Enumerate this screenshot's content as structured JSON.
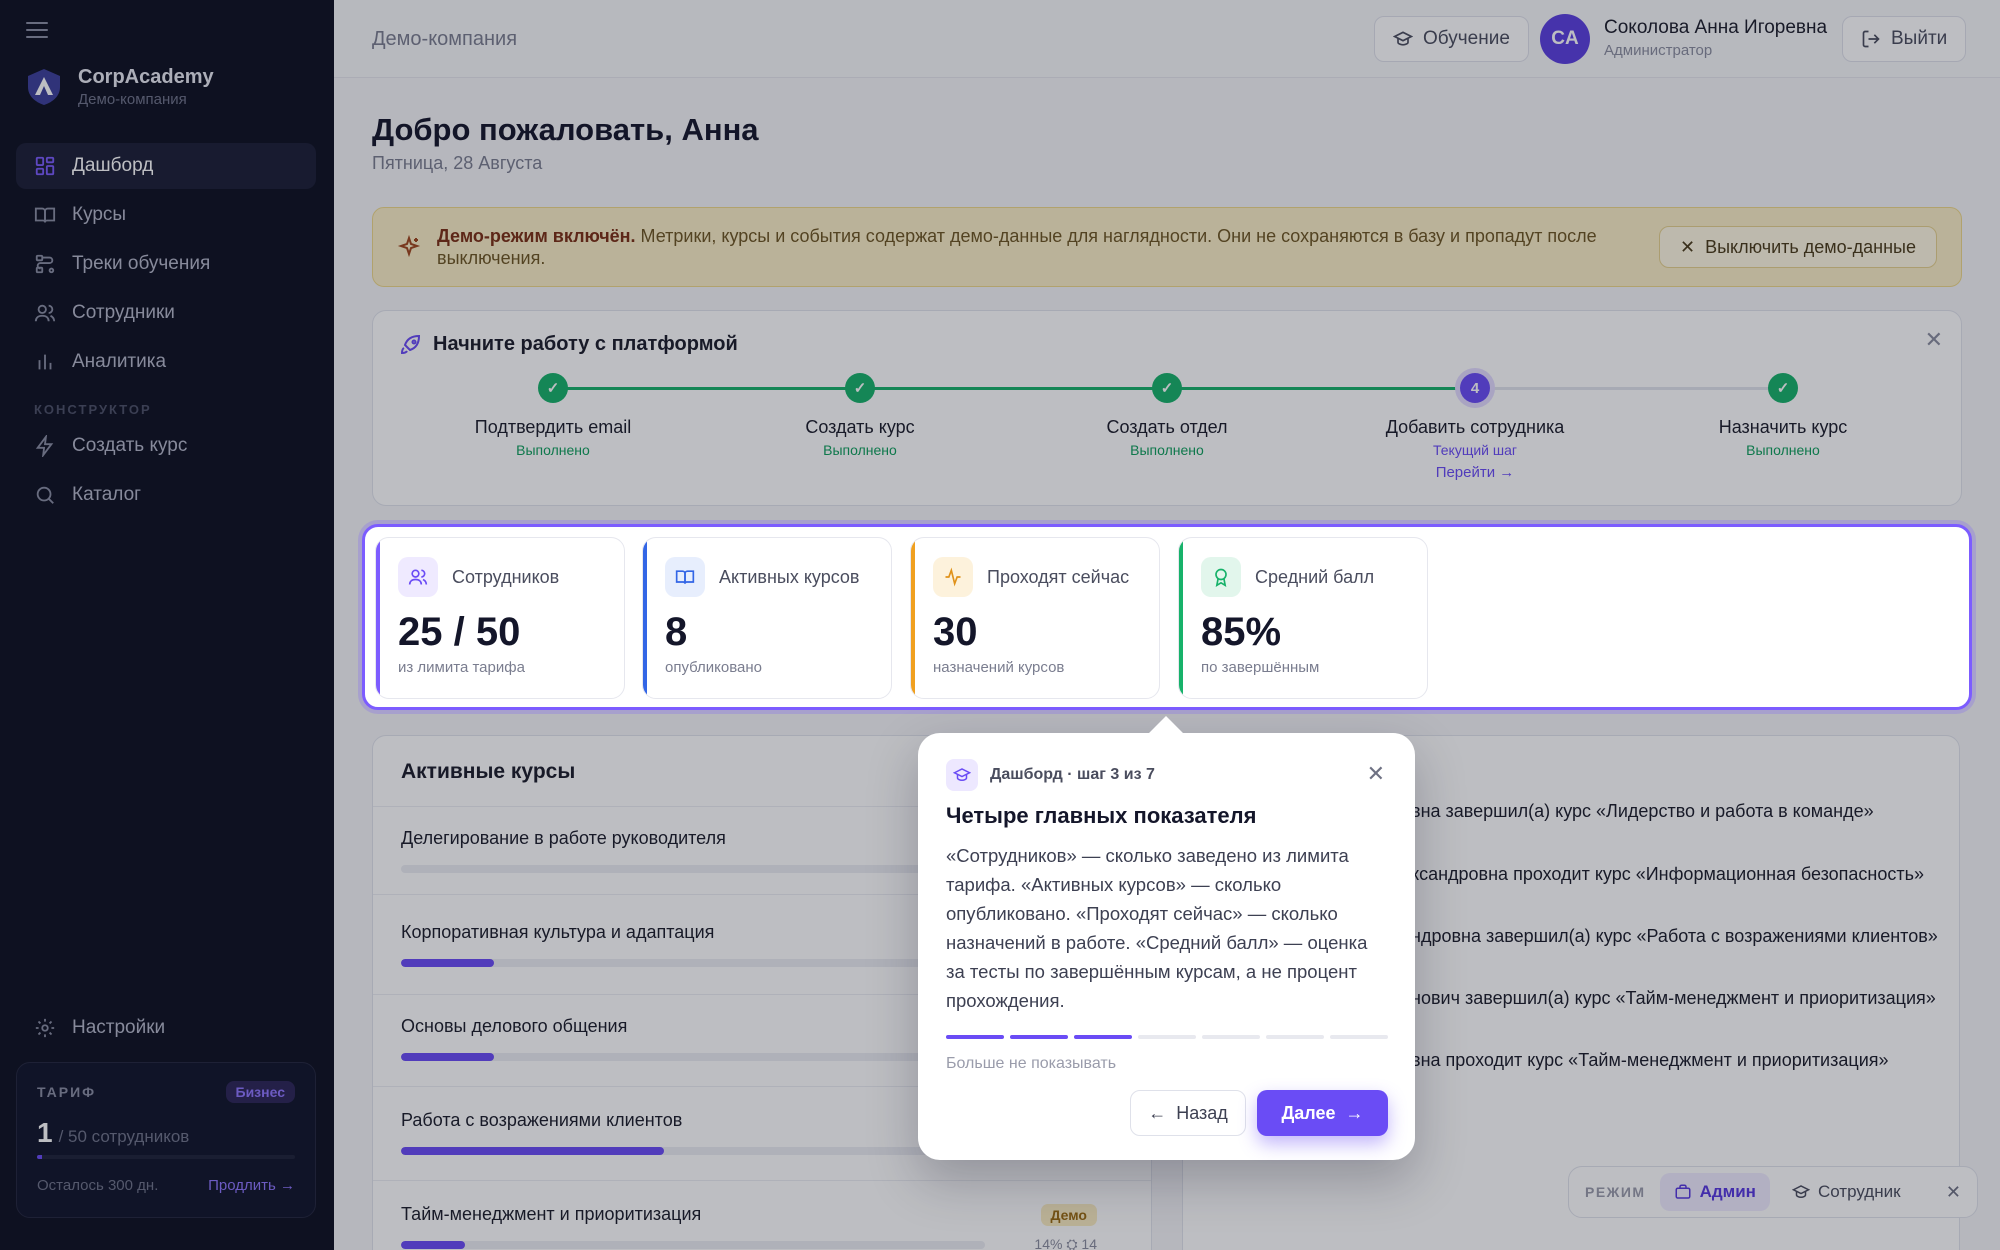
{
  "sidebar": {
    "brand_name": "CorpAcademy",
    "brand_sub": "Демо-компания",
    "nav": [
      {
        "label": "Дашборд",
        "icon": "dashboard-icon",
        "active": true
      },
      {
        "label": "Курсы",
        "icon": "book-icon"
      },
      {
        "label": "Треки обучения",
        "icon": "tracks-icon"
      },
      {
        "label": "Сотрудники",
        "icon": "users-icon"
      },
      {
        "label": "Аналитика",
        "icon": "chart-icon"
      }
    ],
    "section_label": "КОНСТРУКТОР",
    "nav2": [
      {
        "label": "Создать курс",
        "icon": "lightning-icon"
      },
      {
        "label": "Каталог",
        "icon": "search-icon"
      }
    ],
    "settings_label": "Настройки",
    "tariff": {
      "label": "ТАРИФ",
      "badge": "Бизнес",
      "count": "1",
      "of": "/ 50 сотрудников",
      "usage_fraction": 0.02,
      "left": "Осталось 300 дн.",
      "extend": "Продлить →"
    }
  },
  "topbar": {
    "company": "Демо-компания",
    "learn": "Обучение",
    "avatar": "CA",
    "user_name": "Соколова Анна Игоревна",
    "user_role": "Администратор",
    "logout": "Выйти"
  },
  "page": {
    "title": "Добро пожаловать, Анна",
    "date": "Пятница, 28 Августа"
  },
  "banner": {
    "bold": "Демо-режим включён.",
    "text": " Метрики, курсы и события содержат демо-данные для наглядности. Они не сохраняются в базу и пропадут после выключения.",
    "button": "Выключить демо-данные"
  },
  "onboarding": {
    "title": "Начните работу с платформой",
    "steps": [
      {
        "label": "Подтвердить email",
        "status": "Выполнено",
        "state": "done"
      },
      {
        "label": "Создать курс",
        "status": "Выполнено",
        "state": "done"
      },
      {
        "label": "Создать отдел",
        "status": "Выполнено",
        "state": "done"
      },
      {
        "label": "Добавить сотрудника",
        "status": "Текущий шаг",
        "state": "current",
        "number": "4",
        "link": "Перейти →"
      },
      {
        "label": "Назначить курс",
        "status": "Выполнено",
        "state": "done"
      }
    ]
  },
  "stats": [
    {
      "label": "Сотрудников",
      "value": "25 / 50",
      "sub": "из лимита тарифа",
      "accent": "#7c5cff",
      "icon": "users-icon"
    },
    {
      "label": "Активных курсов",
      "value": "8",
      "sub": "опубликовано",
      "accent": "#3366e6",
      "icon": "book-icon"
    },
    {
      "label": "Проходят сейчас",
      "value": "30",
      "sub": "назначений курсов",
      "accent": "#f0a020",
      "icon": "activity-icon"
    },
    {
      "label": "Средний балл",
      "value": "85%",
      "sub": "по завершённым",
      "accent": "#17b26a",
      "icon": "award-icon"
    }
  ],
  "active_courses": {
    "title": "Активные курсы",
    "items": [
      {
        "name": "Делегирование в работе руководителя",
        "progress": 0
      },
      {
        "name": "Корпоративная культура и адаптация",
        "progress": 0.16
      },
      {
        "name": "Основы делового общения",
        "progress": 0.16
      },
      {
        "name": "Работа с возражениями клиентов",
        "progress": 0.45
      },
      {
        "name": "Тайм-менеджмент и приоритизация",
        "progress": 0.11,
        "tag": "Демо",
        "meta": "14%  ⛭ 14"
      }
    ]
  },
  "events": [
    "вна завершил(а) курс «Лидерство и работа в команде»",
    "ксандровна проходит курс «Информационная безопасность»",
    "ндровна завершил(а) курс «Работа с возражениями клиентов»",
    "нович завершил(а) курс «Тайм-менеджмент и приоритизация»",
    "вна проходит курс «Тайм-менеджмент и приоритизация»"
  ],
  "tour": {
    "step": "Дашборд · шаг 3 из 7",
    "title": "Четыре главных показателя",
    "body": "«Сотрудников» — сколько заведено из лимита тарифа. «Активных курсов» — сколько опубликовано. «Проходят сейчас» — сколько назначений в работе. «Средний балл» — оценка за тесты по завершённым курсам, а не процент прохождения.",
    "total": 7,
    "current": 3,
    "hide": "Больше не показывать",
    "back": "Назад",
    "next": "Далее"
  },
  "mode": {
    "label": "РЕЖИМ",
    "admin": "Админ",
    "employee": "Сотрудник"
  }
}
